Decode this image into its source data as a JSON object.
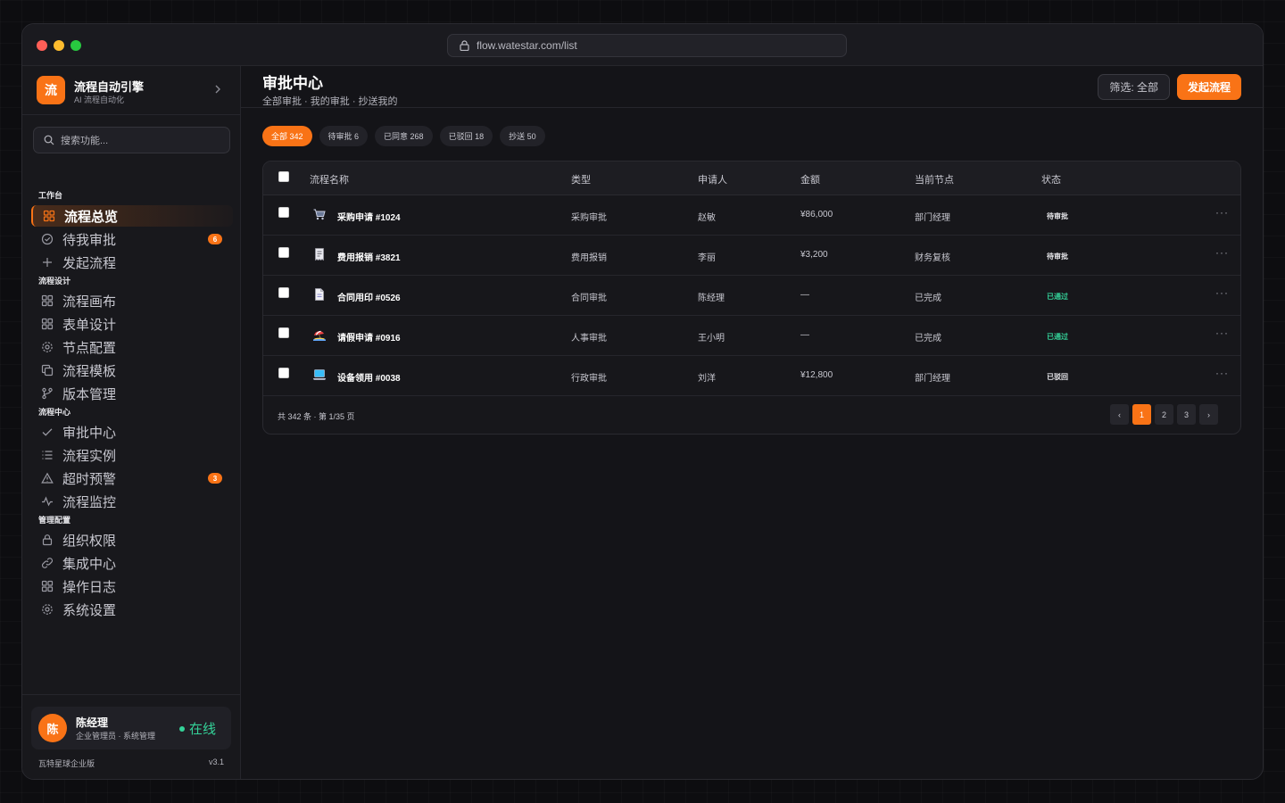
{
  "browser": {
    "url": "flow.watestar.com/list",
    "dot_colors": [
      "#ff5f57",
      "#febc2e",
      "#28c840"
    ]
  },
  "brand": {
    "logo_text": "流",
    "title": "流程自动引擎",
    "subtitle": "AI 流程自动化"
  },
  "search": {
    "placeholder": "搜索功能..."
  },
  "sidebar": {
    "sections": [
      {
        "label": "工作台"
      },
      {
        "label": "流程设计"
      },
      {
        "label": "流程中心"
      },
      {
        "label": "管理配置"
      }
    ],
    "items": [
      {
        "label": "流程总览",
        "icon": "grid-icon"
      },
      {
        "label": "待我审批",
        "icon": "check-circle-icon",
        "badge": "6"
      },
      {
        "label": "发起流程",
        "icon": "plus-icon"
      },
      {
        "label": "流程画布",
        "icon": "grid-icon"
      },
      {
        "label": "表单设计",
        "icon": "grid-icon"
      },
      {
        "label": "节点配置",
        "icon": "gear-icon"
      },
      {
        "label": "流程模板",
        "icon": "copy-icon"
      },
      {
        "label": "版本管理",
        "icon": "branch-icon"
      },
      {
        "label": "审批中心",
        "icon": "check-icon"
      },
      {
        "label": "流程实例",
        "icon": "list-icon"
      },
      {
        "label": "超时预警",
        "icon": "warning-icon",
        "badge": "3"
      },
      {
        "label": "流程监控",
        "icon": "activity-icon"
      },
      {
        "label": "组织权限",
        "icon": "lock-icon"
      },
      {
        "label": "集成中心",
        "icon": "link-icon"
      },
      {
        "label": "操作日志",
        "icon": "grid-icon"
      },
      {
        "label": "系统设置",
        "icon": "gear-icon"
      }
    ]
  },
  "user": {
    "avatar_text": "陈",
    "name": "陈经理",
    "role": "企业管理员 · 系统管理",
    "status": "在线",
    "edition": "瓦特星球企业版",
    "version": "v3.1"
  },
  "header": {
    "title": "审批中心",
    "subtitle": "全部审批 · 我的审批 · 抄送我的",
    "filter_label": "筛选: 全部",
    "primary_label": "发起流程"
  },
  "tabs": [
    {
      "label": "全部 342"
    },
    {
      "label": "待审批 6"
    },
    {
      "label": "已同意 268"
    },
    {
      "label": "已驳回 18"
    },
    {
      "label": "抄送 50"
    }
  ],
  "table": {
    "columns": [
      "流程名称",
      "类型",
      "申请人",
      "金额",
      "当前节点",
      "状态"
    ],
    "rows": [
      {
        "icon": "cart-icon",
        "name": "采购申请 #1024",
        "type": "采购审批",
        "applicant": "赵敏",
        "amount": "¥86,000",
        "node": "部门经理",
        "status": "待审批",
        "status_kind": "pending"
      },
      {
        "icon": "receipt-icon",
        "name": "费用报销 #3821",
        "type": "费用报销",
        "applicant": "李丽",
        "amount": "¥3,200",
        "node": "财务复核",
        "status": "待审批",
        "status_kind": "pending"
      },
      {
        "icon": "document-icon",
        "name": "合同用印 #0526",
        "type": "合同审批",
        "applicant": "陈经理",
        "amount": "—",
        "node": "已完成",
        "status": "已通过",
        "status_kind": "approved"
      },
      {
        "icon": "beach-icon",
        "name": "请假申请 #0916",
        "type": "人事审批",
        "applicant": "王小明",
        "amount": "—",
        "node": "已完成",
        "status": "已通过",
        "status_kind": "approved"
      },
      {
        "icon": "laptop-icon",
        "name": "设备领用 #0038",
        "type": "行政审批",
        "applicant": "刘洋",
        "amount": "¥12,800",
        "node": "部门经理",
        "status": "已驳回",
        "status_kind": "rejected"
      }
    ],
    "row_action": "···",
    "footer_total": "共 342 条 · 第 1/35 页",
    "pager": [
      "‹",
      "1",
      "2",
      "3",
      "›"
    ],
    "current_page": "1"
  },
  "colors": {
    "accent": "#f97316",
    "success": "#34d399"
  }
}
